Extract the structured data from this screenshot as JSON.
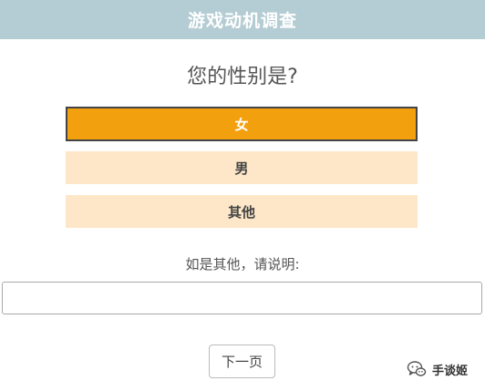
{
  "header": {
    "title": "游戏动机调查"
  },
  "question": {
    "text": "您的性别是?"
  },
  "options": [
    {
      "label": "女",
      "selected": true
    },
    {
      "label": "男",
      "selected": false
    },
    {
      "label": "其他",
      "selected": false
    }
  ],
  "other": {
    "label": "如是其他，请说明:",
    "value": "",
    "placeholder": ""
  },
  "navigation": {
    "next_label": "下一页"
  },
  "watermark": {
    "icon": "wechat-bubble-icon",
    "text": "手谈姬"
  },
  "colors": {
    "header_bg": "#b4ccd3",
    "selected_bg": "#f3a00f",
    "option_bg": "#fde7c8"
  }
}
